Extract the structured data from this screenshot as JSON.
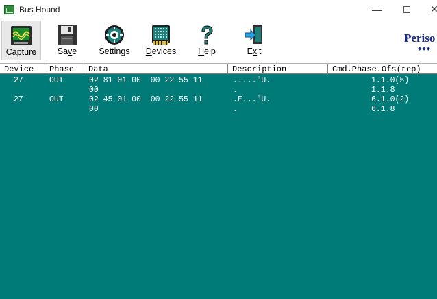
{
  "window": {
    "title": "Bus Hound",
    "minimize_glyph": "—",
    "close_glyph": "✕"
  },
  "toolbar": {
    "buttons": [
      {
        "key": "capture",
        "underline": "C",
        "rest": "apture",
        "icon": "capture-waveform-icon",
        "active": true
      },
      {
        "key": "save",
        "prefix": "Sa",
        "underline": "v",
        "rest": "e",
        "icon": "floppy-disk-icon"
      },
      {
        "key": "settings",
        "label": "Settings",
        "icon": "settings-dial-icon"
      },
      {
        "key": "devices",
        "underline": "D",
        "rest": "evices",
        "icon": "device-chip-icon"
      },
      {
        "key": "help",
        "underline": "H",
        "rest": "elp",
        "icon": "question-mark-icon"
      },
      {
        "key": "exit",
        "prefix": "E",
        "underline": "x",
        "rest": "it",
        "icon": "exit-door-icon"
      }
    ],
    "brand": "Periso",
    "brand_dots": "◆◆◆"
  },
  "columns": [
    "Device",
    "Phase",
    "Data",
    "Description",
    "Cmd.Phase.Ofs(rep)"
  ],
  "rows": [
    {
      "device": "27",
      "phase": "OUT",
      "data_line1": "02 81 01 00  00 22 55 11",
      "data_line2": "00",
      "desc_line1": ".....\"U.",
      "desc_line2": ".",
      "cmd_line1": "1.1.0(5)",
      "cmd_line2": "1.1.8"
    },
    {
      "device": "27",
      "phase": "OUT",
      "data_line1": "02 45 01 00  00 22 55 11",
      "data_line2": "00",
      "desc_line1": ".E...\"U.",
      "desc_line2": ".",
      "cmd_line1": "6.1.0(2)",
      "cmd_line2": "6.1.8"
    }
  ],
  "colors": {
    "data_background": "#007b78",
    "data_text": "#ffffff",
    "brand": "#1a2c8c"
  }
}
